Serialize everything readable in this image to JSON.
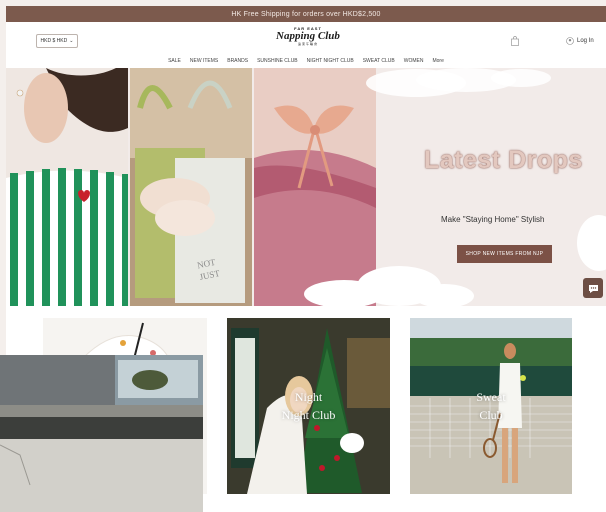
{
  "promo_bar": {
    "text": "HK Free Shipping for orders over HKD$2,500"
  },
  "header": {
    "currency": "HKD $ HKD",
    "logo_top": "FAR EAST",
    "logo_main": "Napping Club",
    "logo_sub": "遠東午睡會",
    "login_label": "Log In"
  },
  "nav": {
    "items": [
      "SALE",
      "NEW ITEMS",
      "BRANDS",
      "SUNSHINE CLUB",
      "NIGHT NIGHT CLUB",
      "SWEAT CLUB",
      "WOMEN",
      "More"
    ]
  },
  "hero": {
    "title": "Latest Drops",
    "subtitle": "Make \"Staying Home\" Stylish",
    "button_label": "SHOP NEW ITEMS FROM NJP"
  },
  "cards": [
    {
      "label": ""
    },
    {
      "label": "Night\nNight Club"
    },
    {
      "label": "Sweat\nClub"
    }
  ],
  "colors": {
    "brown": "#7c5a4d",
    "button": "#7c5146",
    "title": "#e3c8bf"
  }
}
